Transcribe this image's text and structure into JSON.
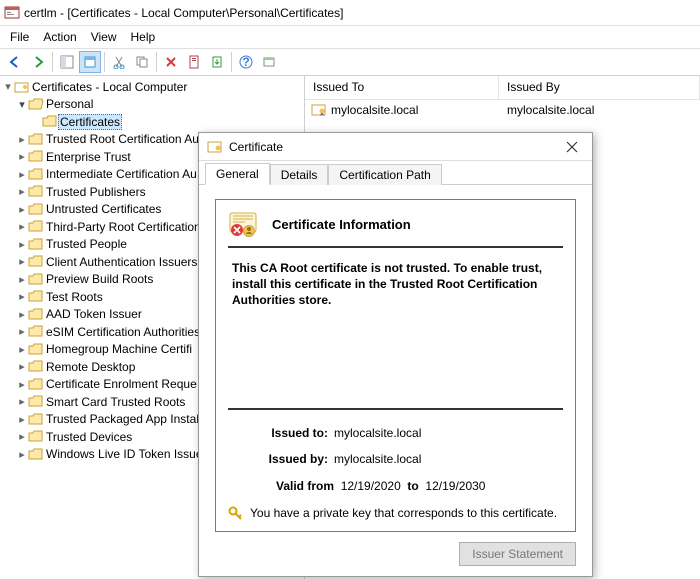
{
  "title": "certlm - [Certificates - Local Computer\\Personal\\Certificates]",
  "menu": {
    "file": "File",
    "action": "Action",
    "view": "View",
    "help": "Help"
  },
  "tree": {
    "root": "Certificates - Local Computer",
    "personal": "Personal",
    "certificates": "Certificates",
    "items": [
      "Trusted Root Certification Au",
      "Enterprise Trust",
      "Intermediate Certification Au",
      "Trusted Publishers",
      "Untrusted Certificates",
      "Third-Party Root Certification",
      "Trusted People",
      "Client Authentication Issuers",
      "Preview Build Roots",
      "Test Roots",
      "AAD Token Issuer",
      "eSIM Certification Authorities",
      "Homegroup Machine Certifi",
      "Remote Desktop",
      "Certificate Enrolment Reque",
      "Smart Card Trusted Roots",
      "Trusted Packaged App Instal",
      "Trusted Devices",
      "Windows Live ID Token Issue"
    ]
  },
  "list": {
    "col_issued_to": "Issued To",
    "col_issued_by": "Issued By",
    "row_to": "mylocalsite.local",
    "row_by": "mylocalsite.local"
  },
  "dialog": {
    "title": "Certificate",
    "tab_general": "General",
    "tab_details": "Details",
    "tab_path": "Certification Path",
    "header": "Certificate Information",
    "warning": "This CA Root certificate is not trusted. To enable trust, install this certificate in the Trusted Root Certification Authorities store.",
    "issued_to_lbl": "Issued to:",
    "issued_to_val": "mylocalsite.local",
    "issued_by_lbl": "Issued by:",
    "issued_by_val": "mylocalsite.local",
    "valid_from_lbl": "Valid from",
    "valid_from_val": "12/19/2020",
    "valid_to_lbl": "to",
    "valid_to_val": "12/19/2030",
    "key_text": "You have a private key that corresponds to this certificate.",
    "issuer_statement": "Issuer Statement"
  }
}
